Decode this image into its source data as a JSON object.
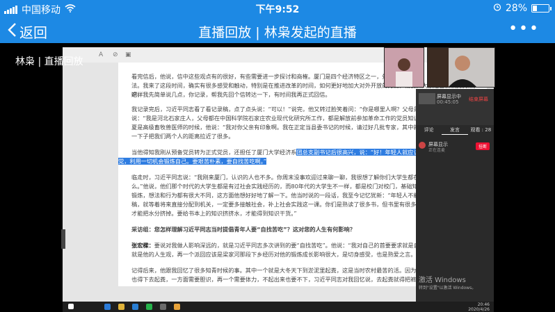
{
  "status_bar": {
    "carrier": "中国移动",
    "time": "下午9:52",
    "battery": "28%",
    "battery_level": 0.28,
    "icons": [
      "signal-icon",
      "wifi-icon",
      "alarm-icon",
      "battery-icon"
    ]
  },
  "nav": {
    "back_label": "返回",
    "title": "直播回放 | 林枭发起的直播",
    "more_label": "•••"
  },
  "overlay": {
    "title": "林枭 | 直播回放"
  },
  "doc": {
    "toolbar": [
      "A",
      "A"
    ],
    "paragraphs": [
      "看完信后，他说，信中这些观点有的很好，有些需要进一步探讨和商榷。厦门是四个经济特区之一，处",
      "法。我来了这段时间，确实有很多感受和触动，特别是在推进改革的时间，如何更好地加大对外开放的力度，需要集大家之智和认真调研。这样",
      "吧，我先简单说几点，你记录，帮我先回个信转达一下，有时间我再正式回信。",
      "我记录完后，习近平同志看了看记录稿，点了点头说：“可以！”说完，他又转过脸笑着问：“你是哪里人啊？父母是干什么的呀？”我",
      "说：“我是河北石家庄人，父母都在中国科学院石家庄农业现代化研究所工作，都是解放前参加革命工作的党员知识分子。”",
      "夏是高级畜牧兽医师的时候，他说：“我对你父亲有印象啊。我在正定当县委书记的时候，请过好几批专家，其中就有你父",
      "一下子把我们两个人的距离拉近了很多。"
    ],
    "highlight_pre": "当他得知我刚从预备党员转为正式党员，还担任了厦门大学经济系",
    "highlight_text": "团总支副书记后很高兴，说：“好！年轻人就应该要",
    "highlight_line2": "党，利用一切机会锻炼自己。要艰苦朴素，要自找苦吃啊。”",
    "paragraphs2": [
      "临走时，习近平同志说：“我刚来厦门，认识的人也不多。你周末没事欢迎过来聊一聊，我很想了解你们大学生都在学",
      "么。”他说，他们那个时代的大学生都是有过社会实践经历的，而80年代的大学生不一样，都是校门对校门，基础知识比较",
      "锻炼，想法和行为都有很大不同，这方面他想好好地了解一下。他当时说的一段话，我至今记忆犹新：“年轻人不能认为这",
      "稿，就等着将来直接分配到机关，一定要多接触社会，补上社会实践这一课。你们是熟读了很多书，但书里有很多水分，只有",
      "才能把水分挤掉。要给书本上的知识挤挤水，才能得到知识干货。”"
    ],
    "question": "采访组：您怎样理解习近平同志当时提倡青年人要“自找苦吃”？这对您的人生有何影响？",
    "answer_speaker": "张宏樑：",
    "answer_lines": [
      "要说对我做人影响深远的，就是习近平同志多次讲到的要“自找苦吃”。他说：“我对自己的首要要求就是自",
      "就是他的人生观，再一个派回应该是梁家河那段下乡经历对他的锻炼成长影响很大，是切身感受，也是熟爱之言。"
    ],
    "last_lines": [
      "记得后来，他跟我回忆了很多知青时候的事。其中一个就是大冬天下到淤泥里起粪，这是当时农村最苦的活。因为冬天",
      "也得下去起粪，一方面需要胆识，再一个需要体力，不起出来也要不下，习近平同志对我回忆说，去起粪就得把裤子腿了",
      "着脚踩进去用铁锹一锹一锹往上起，冰碴把腿和脚划出一道道血印子，他当时只有十几岁，个子不够高，身体也不够强壮，"
    ]
  },
  "chat": {
    "strip_label": "屏幕显示中",
    "strip_time": "00:45:05",
    "strip_btn": "结束屏幕",
    "tabs": [
      "评论",
      "发言",
      "观看 : 28"
    ],
    "user_name": "屏幕显示",
    "user_status": "正在连麦",
    "user_button": "挂断"
  },
  "watermark": {
    "line1": "激活 Windows",
    "line2": "转到\"设置\"以激活 Windows。"
  },
  "taskbar": {
    "time": "20:46",
    "date": "2020/4/26"
  }
}
